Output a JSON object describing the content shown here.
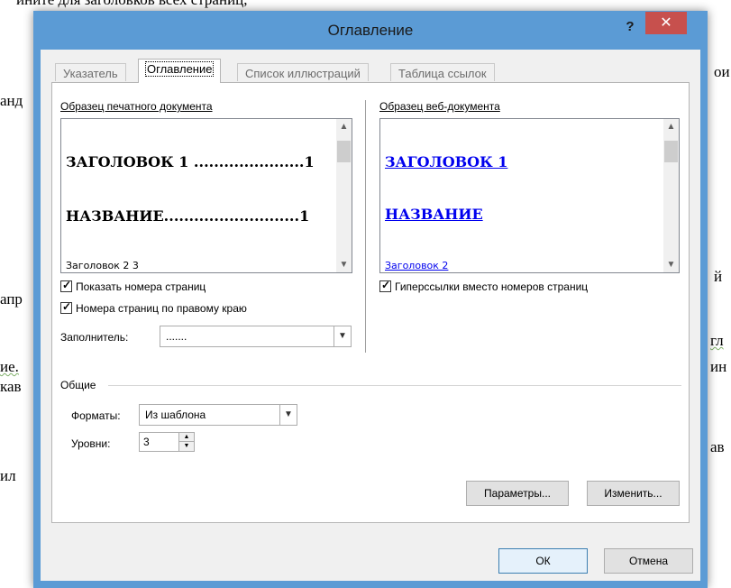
{
  "background_text": {
    "top": "ините для заголовков всех страниц,",
    "left_1": "анд",
    "left_2": "апр",
    "left_3": "ие.",
    "left_4": "кав",
    "left_5": "ил",
    "right_1": "ои",
    "right_2": "й",
    "right_3": "гл",
    "right_4": "ин",
    "right_5": "ав"
  },
  "dialog": {
    "title": "Оглавление",
    "help_label": "?",
    "close_label": "✕"
  },
  "tabs": [
    {
      "label": "Указатель",
      "active": false
    },
    {
      "label": "Оглавление",
      "active": true
    },
    {
      "label": "Список иллюстраций",
      "active": false
    },
    {
      "label": "Таблица ссылок",
      "active": false
    }
  ],
  "print_preview": {
    "label": "Образец печатного документа",
    "items": [
      "ЗАГОЛОВОК 1 ......................1",
      "НАЗВАНИЕ...........................1",
      "Заголовок 2                                     3"
    ]
  },
  "web_preview": {
    "label": "Образец веб-документа",
    "items": [
      "ЗАГОЛОВОК 1",
      "НАЗВАНИЕ",
      "Заголовок 2"
    ]
  },
  "options": {
    "show_page_numbers": {
      "label": "Показать номера страниц",
      "checked": true
    },
    "right_align_page_numbers": {
      "label": "Номера страниц по правому краю",
      "checked": true
    },
    "use_hyperlinks": {
      "label": "Гиперссылки вместо номеров страниц",
      "checked": true
    },
    "tab_leader": {
      "label": "Заполнитель:",
      "value": "......."
    }
  },
  "general": {
    "label": "Общие",
    "formats": {
      "label": "Форматы:",
      "value": "Из шаблона"
    },
    "levels": {
      "label": "Уровни:",
      "value": "3"
    }
  },
  "buttons": {
    "options": "Параметры...",
    "modify": "Изменить...",
    "ok": "ОК",
    "cancel": "Отмена"
  },
  "colors": {
    "accent": "#5b9bd5",
    "close": "#c7504d",
    "link": "#0000ee"
  },
  "icons": {
    "scroll_up": "chevron-up-icon",
    "scroll_down": "chevron-down-icon",
    "dropdown": "chevron-down-icon",
    "checkmark": "checkmark-icon"
  }
}
